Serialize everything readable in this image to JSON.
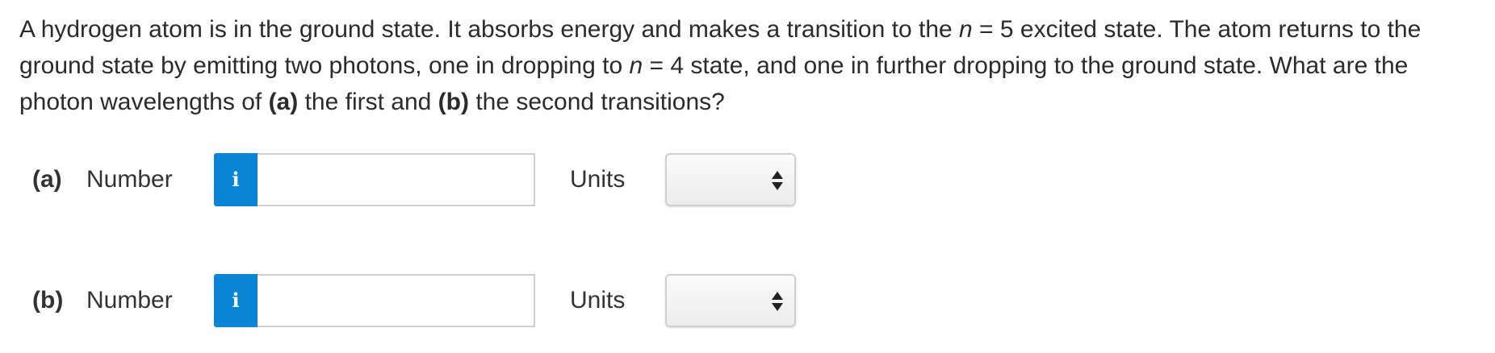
{
  "question": {
    "text_1": "A hydrogen atom is in the ground state. It absorbs energy and makes a transition to the ",
    "n_var_1": "n",
    "text_2": " = 5 excited state. The atom returns to the ground state by emitting two photons, one in dropping to ",
    "n_var_2": "n",
    "text_3": " = 4 state, and one in further dropping to the ground state. What are the photon wavelengths of ",
    "part_a": "(a)",
    "text_4": " the first and ",
    "part_b": "(b)",
    "text_5": " the second transitions?"
  },
  "parts": [
    {
      "label": "(a)",
      "field_label": "Number",
      "info_icon": "i",
      "value": "",
      "units_label": "Units",
      "units_selected": ""
    },
    {
      "label": "(b)",
      "field_label": "Number",
      "info_icon": "i",
      "value": "",
      "units_label": "Units",
      "units_selected": ""
    }
  ],
  "colors": {
    "info_button": "#0a84d6",
    "text": "#2b2b2b",
    "input_border": "#cfcfcf"
  },
  "icons": {
    "info": "info-icon",
    "select_arrows": "sort-arrows-icon"
  }
}
